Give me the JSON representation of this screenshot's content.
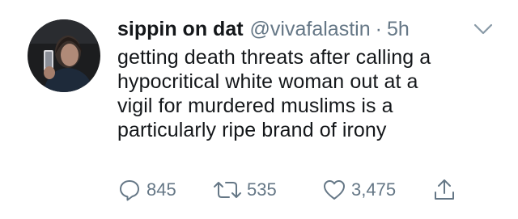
{
  "tweet": {
    "display_name": "sippin on dat",
    "handle": "@vivafalastin",
    "separator": "·",
    "time": "5h",
    "text_lines": [
      "getting death threats after calling a",
      "hypocritical white woman out at a",
      "vigil for murdered muslims is a",
      "particularly ripe brand of irony"
    ]
  },
  "actions": {
    "reply_count": "845",
    "retweet_count": "535",
    "like_count": "3,475"
  },
  "icons": {
    "avatar": "avatar-photo",
    "caret": "chevron-down-icon",
    "reply": "reply-icon",
    "retweet": "retweet-icon",
    "like": "heart-icon",
    "share": "share-icon"
  },
  "colors": {
    "text": "#14171a",
    "secondary": "#657786",
    "background": "#ffffff"
  }
}
